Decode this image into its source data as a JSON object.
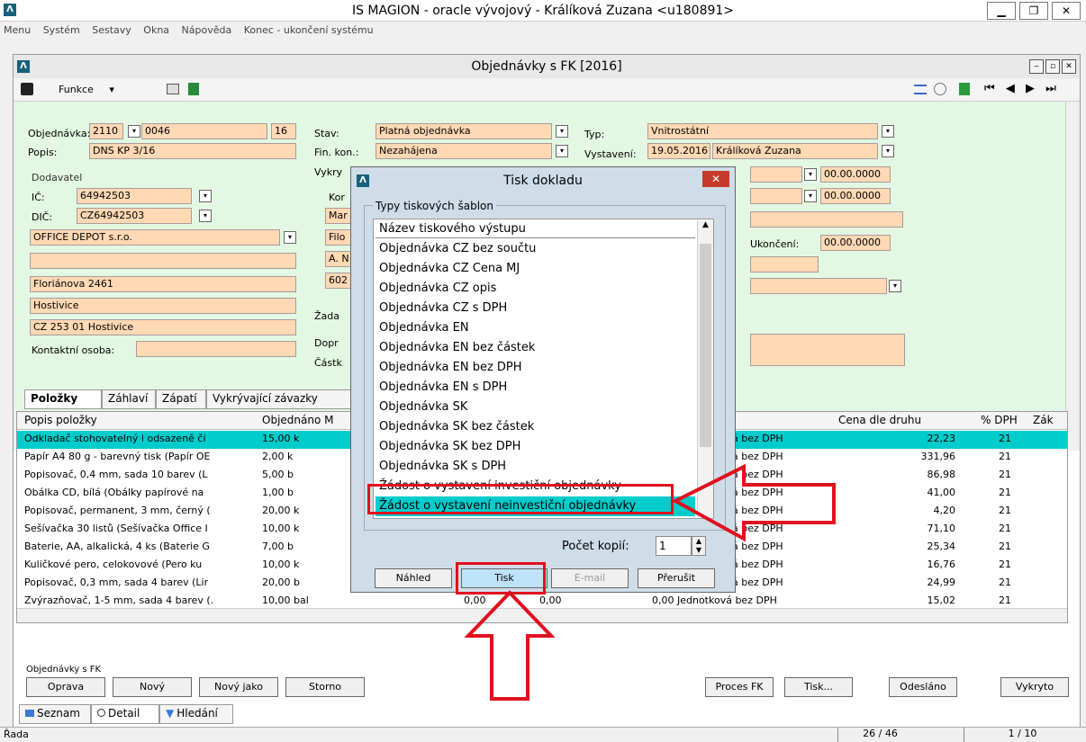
{
  "app": {
    "window_title": "IS MAGION - oracle vývojový - Králíková Zuzana <u180891>",
    "logo_letter": "Λ",
    "win_min": "▁",
    "win_max": "❐",
    "win_close": "✕",
    "menu": [
      "Menu",
      "Systém",
      "Sestavy",
      "Okna",
      "Nápověda",
      "Konec - ukončení systému"
    ]
  },
  "inner": {
    "title": "Objednávky s FK [2016]",
    "btn_min": "‒",
    "btn_max": "▫",
    "btn_close": "✕",
    "toolbar": {
      "funkce": "Funkce",
      "dropdown_arrow": "▾"
    },
    "nav": [
      "⏮",
      "◀",
      "▶",
      "⏭"
    ]
  },
  "form": {
    "objednavka_label": "Objednávka:",
    "objednavka_1": "2110",
    "objednavka_2": "0046",
    "objednavka_3": "16",
    "popis_label": "Popis:",
    "popis": "DNS KP 3/16",
    "dodavatel_label": "Dodavatel",
    "ic_label": "IČ:",
    "ic": "64942503",
    "dic_label": "DIČ:",
    "dic": "CZ64942503",
    "firma": "OFFICE DEPOT s.r.o.",
    "ulice": "Floriánova 2461",
    "obec": "Hostivice",
    "psc": "CZ  253 01  Hostivice",
    "kontakt_label": "Kontaktní osoba:",
    "stav_label": "Stav:",
    "stav": "Platná objednávka",
    "fin_kon_label": "Fin. kon.:",
    "fin_kon": "Nezahájena",
    "vykryti_label": "Vykry",
    "kon_label": "Kor",
    "field_ma": "Mar",
    "field_filo": "Filo",
    "field_an": "A. N",
    "field_602": "602",
    "zadat_label": "Žada",
    "doprava_label": "Dopr",
    "castka_label": "Částk",
    "typ_label": "Typ:",
    "typ": "Vnitrostátní",
    "vystaveni_label": "Vystavení:",
    "vystaveni_datum": "19.05.2016",
    "vystaveni_osoba": "Králíková Zuzana",
    "datum_1": "00.00.0000",
    "datum_2": "00.00.0000",
    "ukonceni_label": "Ukončení:",
    "ukonceni": "00.00.0000"
  },
  "tabs": [
    "Položky",
    "Záhlaví",
    "Zápatí",
    "Vykrývající závazky"
  ],
  "grid": {
    "headers": {
      "popis": "Popis položky",
      "objednano": "Objednáno  M",
      "cena": "Cena dle druhu",
      "dph": "% DPH",
      "zak": "Zák"
    },
    "rows": [
      {
        "popis": "Odkladač stohovatelný i odsazeně či",
        "obj": "15,00 k",
        "typ": "á bez DPH",
        "cena": "22,23",
        "dph": "21"
      },
      {
        "popis": "Papír A4 80 g - barevný tisk (Papír OE",
        "obj": "2,00 k",
        "typ": "á bez DPH",
        "cena": "331,96",
        "dph": "21"
      },
      {
        "popis": "Popisovač, 0,4 mm, sada 10 barev (L",
        "obj": "5,00 b",
        "typ": "á bez DPH",
        "cena": "86,98",
        "dph": "21"
      },
      {
        "popis": "Obálka CD, bílá (Obálky papírové na",
        "obj": "1,00 b",
        "typ": "á bez DPH",
        "cena": "41,00",
        "dph": "21"
      },
      {
        "popis": "Popisovač, permanent, 3 mm, černý (",
        "obj": "20,00 k",
        "typ": "á bez DPH",
        "cena": "4,20",
        "dph": "21"
      },
      {
        "popis": "Sešívačka 30 listů (Sešívačka Office I",
        "obj": "10,00 k",
        "typ": "á bez DPH",
        "cena": "71,10",
        "dph": "21"
      },
      {
        "popis": "Baterie, AA, alkalická, 4 ks (Baterie G",
        "obj": "7,00 b",
        "typ": "á bez DPH",
        "cena": "25,34",
        "dph": "21"
      },
      {
        "popis": "Kuličkové pero, celokovové (Pero ku",
        "obj": "10,00 k",
        "typ": "á bez DPH",
        "cena": "16,76",
        "dph": "21"
      },
      {
        "popis": "Popisovač, 0,3 mm, sada 4 barev (Lir",
        "obj": "20,00 b",
        "typ": "á bez DPH",
        "cena": "24,99",
        "dph": "21"
      },
      {
        "popis": "Zvýrazňovač, 1-5 mm, sada 4 barev (.",
        "obj": "10,00 bal",
        "typ": "0,00 Jednotková bez DPH",
        "cena": "15,02",
        "dph": "21"
      }
    ],
    "last_row_extra_1": "0,00",
    "last_row_extra_2": "0,00"
  },
  "bottom": {
    "group_label": "Objednávky s FK",
    "buttons_left": [
      "Oprava",
      "Nový",
      "Nový jako",
      "Storno"
    ],
    "buttons_right": [
      "Proces FK",
      "Tisk...",
      "Odesláno",
      "Vykryto"
    ],
    "views": [
      "Seznam",
      "Detail",
      "Hledání"
    ]
  },
  "status": {
    "text": "Řada",
    "count": "26 / 46",
    "page": "1 / 10"
  },
  "dialog": {
    "title": "Tisk dokladu",
    "close": "✕",
    "group_label": "Typy tiskových šablon",
    "list_header": "Název tiskového výstupu",
    "items": [
      "Objednávka CZ bez součtu",
      "Objednávka CZ Cena MJ",
      "Objednávka CZ opis",
      "Objednávka CZ s DPH",
      "Objednávka EN",
      "Objednávka EN bez částek",
      "Objednávka EN bez DPH",
      "Objednávka EN s DPH",
      "Objednávka SK",
      "Objednávka SK bez částek",
      "Objednávka SK bez DPH",
      "Objednávka SK s DPH",
      "Žádost o vystavení investiční objednávky",
      "Žádost o vystavení neinvestiční objednávky"
    ],
    "selected_index": 13,
    "kopie_label": "Počet kopií:",
    "kopie_value": "1",
    "btn_nahled": "Náhled",
    "btn_tisk": "Tisk",
    "btn_email": "E-mail",
    "btn_prerusit": "Přerušit"
  },
  "colors": {
    "highlight": "#00cccc",
    "annotation_red": "#e0101e",
    "field": "#ffd8b4",
    "form_bg": "#e3f8e3"
  }
}
